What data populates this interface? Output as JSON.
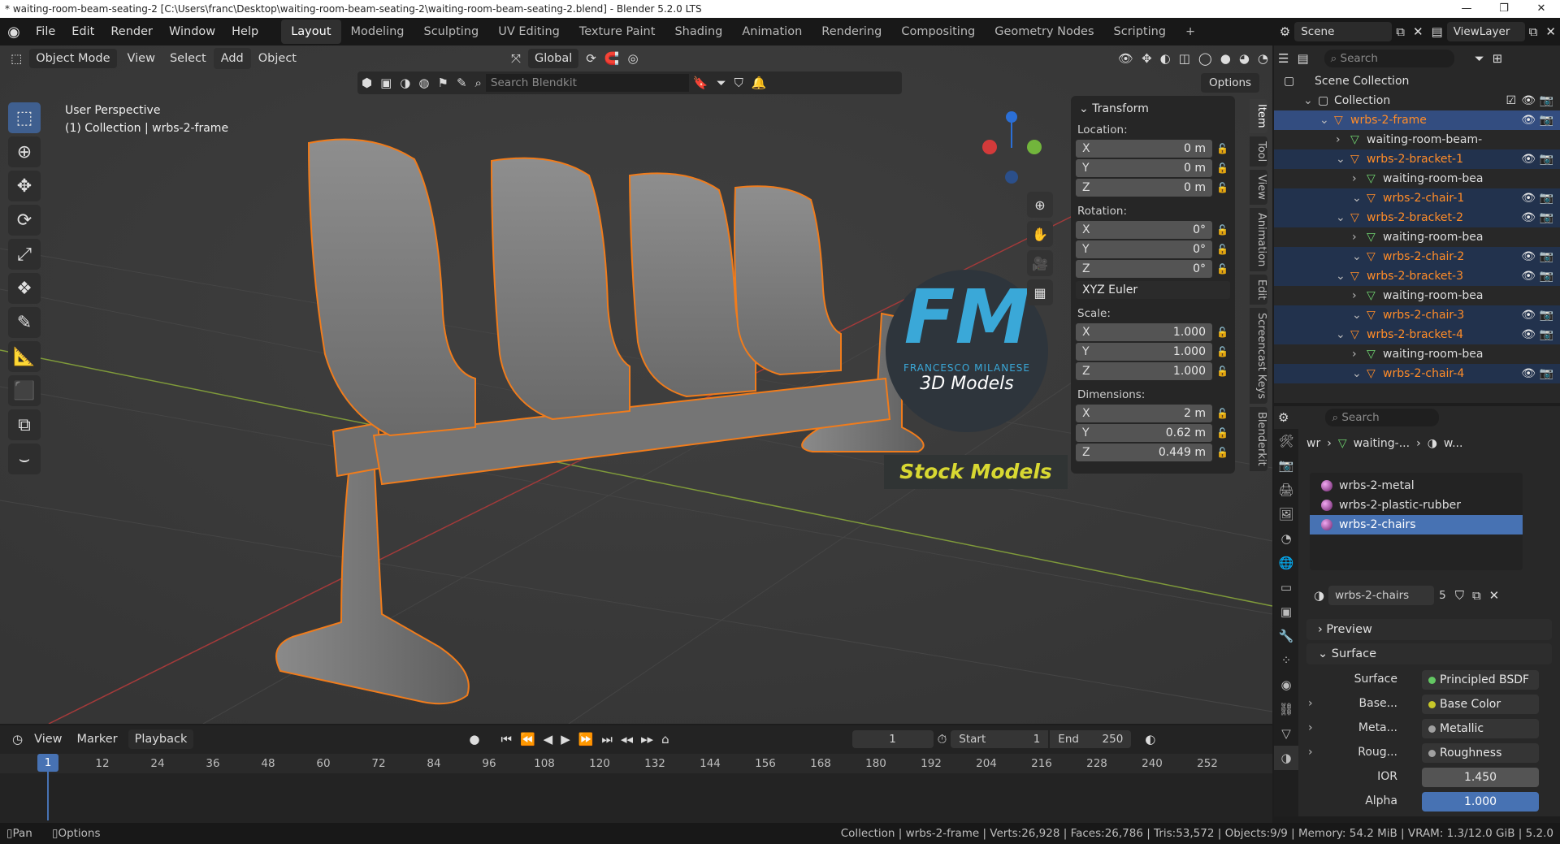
{
  "title": {
    "text": "* waiting-room-beam-seating-2 [C:\\Users\\franc\\Desktop\\waiting-room-beam-seating-2\\waiting-room-beam-seating-2.blend] - Blender 5.2.0 LTS",
    "minimize": "—",
    "maximize": "❐",
    "close": "✕"
  },
  "menu": {
    "file": "File",
    "edit": "Edit",
    "render": "Render",
    "window": "Window",
    "help": "Help"
  },
  "workspaces": [
    "Layout",
    "Modeling",
    "Sculpting",
    "UV Editing",
    "Texture Paint",
    "Shading",
    "Animation",
    "Rendering",
    "Compositing",
    "Geometry Nodes",
    "Scripting"
  ],
  "top_right": {
    "scene": "Scene",
    "viewlayer": "ViewLayer"
  },
  "viewport_header": {
    "mode": "Object Mode",
    "view": "View",
    "select": "Select",
    "add": "Add",
    "object": "Object",
    "orientation": "Global"
  },
  "blenderkit": {
    "search_placeholder": "Search Blendkit",
    "options": "Options"
  },
  "overlay_text": {
    "perspective": "User Perspective",
    "collection": "(1) Collection | wrbs-2-frame"
  },
  "watermark": {
    "letters": "FM",
    "name": "FRANCESCO MILANESE",
    "sub": "3D Models",
    "stock": "Stock Models"
  },
  "transform": {
    "title": "Transform",
    "location": "Location:",
    "rotation": "Rotation:",
    "scale": "Scale:",
    "dimensions": "Dimensions:",
    "euler": "XYZ Euler",
    "loc": [
      {
        "k": "X",
        "v": "0 m"
      },
      {
        "k": "Y",
        "v": "0 m"
      },
      {
        "k": "Z",
        "v": "0 m"
      }
    ],
    "rot": [
      {
        "k": "X",
        "v": "0°"
      },
      {
        "k": "Y",
        "v": "0°"
      },
      {
        "k": "Z",
        "v": "0°"
      }
    ],
    "scl": [
      {
        "k": "X",
        "v": "1.000"
      },
      {
        "k": "Y",
        "v": "1.000"
      },
      {
        "k": "Z",
        "v": "1.000"
      }
    ],
    "dim": [
      {
        "k": "X",
        "v": "2 m"
      },
      {
        "k": "Y",
        "v": "0.62 m"
      },
      {
        "k": "Z",
        "v": "0.449 m"
      }
    ]
  },
  "side_tabs": [
    "Item",
    "Tool",
    "View",
    "Animation",
    "Edit",
    "Screencast Keys",
    "Blenderkit"
  ],
  "outliner": {
    "search": "Search",
    "scene_collection": "Scene Collection",
    "rows": [
      {
        "name": "Collection",
        "indent": 2,
        "type": "coll",
        "cls": ""
      },
      {
        "name": "wrbs-2-frame",
        "indent": 3,
        "type": "obj",
        "cls": "sel"
      },
      {
        "name": "waiting-room-beam-",
        "indent": 4,
        "type": "mesh",
        "cls": ""
      },
      {
        "name": "wrbs-2-bracket-1",
        "indent": 4,
        "type": "obj",
        "cls": "sel2"
      },
      {
        "name": "waiting-room-bea",
        "indent": 5,
        "type": "mesh",
        "cls": ""
      },
      {
        "name": "wrbs-2-chair-1",
        "indent": 5,
        "type": "obj",
        "cls": "sel2"
      },
      {
        "name": "wrbs-2-bracket-2",
        "indent": 4,
        "type": "obj",
        "cls": "sel2"
      },
      {
        "name": "waiting-room-bea",
        "indent": 5,
        "type": "mesh",
        "cls": ""
      },
      {
        "name": "wrbs-2-chair-2",
        "indent": 5,
        "type": "obj",
        "cls": "sel2"
      },
      {
        "name": "wrbs-2-bracket-3",
        "indent": 4,
        "type": "obj",
        "cls": "sel2"
      },
      {
        "name": "waiting-room-bea",
        "indent": 5,
        "type": "mesh",
        "cls": ""
      },
      {
        "name": "wrbs-2-chair-3",
        "indent": 5,
        "type": "obj",
        "cls": "sel2"
      },
      {
        "name": "wrbs-2-bracket-4",
        "indent": 4,
        "type": "obj",
        "cls": "sel2"
      },
      {
        "name": "waiting-room-bea",
        "indent": 5,
        "type": "mesh",
        "cls": ""
      },
      {
        "name": "wrbs-2-chair-4",
        "indent": 5,
        "type": "obj",
        "cls": "sel2"
      }
    ]
  },
  "properties": {
    "search": "Search",
    "breadcrumb": [
      "wr",
      "waiting-...",
      "w..."
    ],
    "materials": [
      "wrbs-2-metal",
      "wrbs-2-plastic-rubber",
      "wrbs-2-chairs"
    ],
    "material_name": "wrbs-2-chairs",
    "users": "5",
    "preview": "Preview",
    "surface_sec": "Surface",
    "surface": {
      "label": "Surface",
      "value": "Principled BSDF"
    },
    "inputs": [
      {
        "label": "Base...",
        "value": "Base Color"
      },
      {
        "label": "Meta...",
        "value": "Metallic"
      },
      {
        "label": "Roug...",
        "value": "Roughness"
      }
    ],
    "ior": {
      "label": "IOR",
      "value": "1.450"
    },
    "alpha": {
      "label": "Alpha",
      "value": "1.000"
    }
  },
  "timeline": {
    "view": "View",
    "marker": "Marker",
    "playback": "Playback",
    "current": "1",
    "start_label": "Start",
    "start": "1",
    "end_label": "End",
    "end": "250",
    "frames": [
      "1",
      "12",
      "24",
      "36",
      "48",
      "60",
      "72",
      "84",
      "96",
      "108",
      "120",
      "132",
      "144",
      "156",
      "168",
      "180",
      "192",
      "204",
      "216",
      "228",
      "240",
      "252"
    ]
  },
  "status": {
    "pan": "Pan",
    "options": "Options",
    "info": "Collection | wrbs-2-frame | Verts:26,928 | Faces:26,786 | Tris:53,572 | Objects:9/9 | Memory: 54.2 MiB | VRAM: 1.3/12.0 GiB | 5.2.0"
  }
}
